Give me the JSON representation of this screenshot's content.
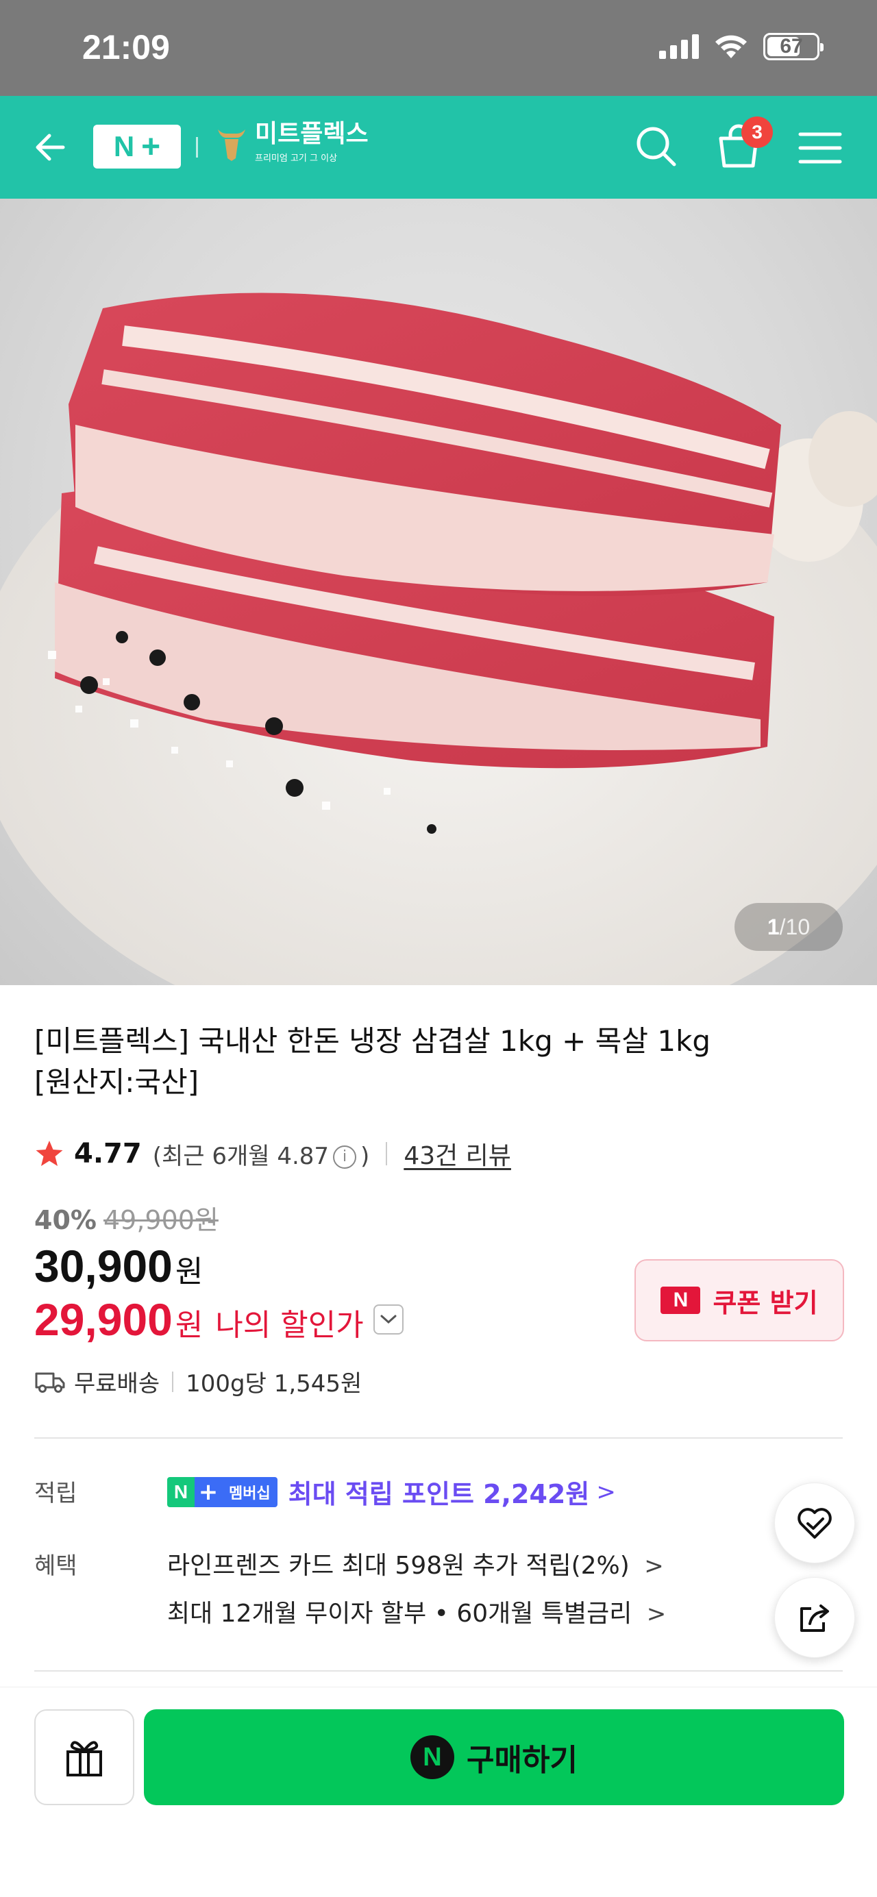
{
  "status_bar": {
    "time": "21:09",
    "battery": "67",
    "battery_level": 0.67
  },
  "nav": {
    "nplus_logo": "N+",
    "brand_name": "미트플렉스",
    "brand_sub": "프리미엄 고기 그 이상",
    "cart_count": "3"
  },
  "hero": {
    "page_current": "1",
    "page_total": "/10"
  },
  "product": {
    "title_line1": "[미트플렉스] 국내산 한돈 냉장 삼겹살 1kg + 목살 1kg",
    "title_line2": "[원산지:국산]",
    "rating": "4.77",
    "recent_rating_prefix": "(최근 6개월 4.87",
    "recent_rating_suffix": ")",
    "info_glyph": "i",
    "review_count": "43건 리뷰",
    "discount_pct": "40%",
    "original_price": "49,900원",
    "price": "30,900",
    "price_unit": "원",
    "my_price": "29,900",
    "my_price_unit": "원",
    "my_price_label": "나의 할인가",
    "coupon_label": "쿠폰 받기",
    "coupon_icon": "N",
    "delivery": "무료배송",
    "unit_price": "100g당 1,545원"
  },
  "benefits": {
    "points_label": "적립",
    "member_badge_n": "N",
    "member_badge_plus": "+",
    "member_badge_text": "멤버십",
    "points_text": "최대 적립 포인트 2,242원",
    "benefit_label": "혜택",
    "benefit_line1": "라인프렌즈 카드 최대 598원 추가 적립(2%)",
    "benefit_line2": "최대 12개월 무이자 할부 • 60개월 특별금리",
    "chevron": ">"
  },
  "bottom": {
    "buy_label": "구매하기",
    "buy_icon": "N"
  },
  "colors": {
    "nav_teal": "#22c3a8",
    "price_red": "#e3163a",
    "points_purple": "#6a4cf2",
    "buy_green": "#03c75a",
    "badge_red": "#f0443d"
  },
  "icons": [
    "back-arrow-icon",
    "search-icon",
    "cart-icon",
    "menu-icon",
    "star-icon",
    "truck-icon",
    "heart-check-icon",
    "share-icon",
    "gift-icon",
    "chevron-down-icon"
  ]
}
